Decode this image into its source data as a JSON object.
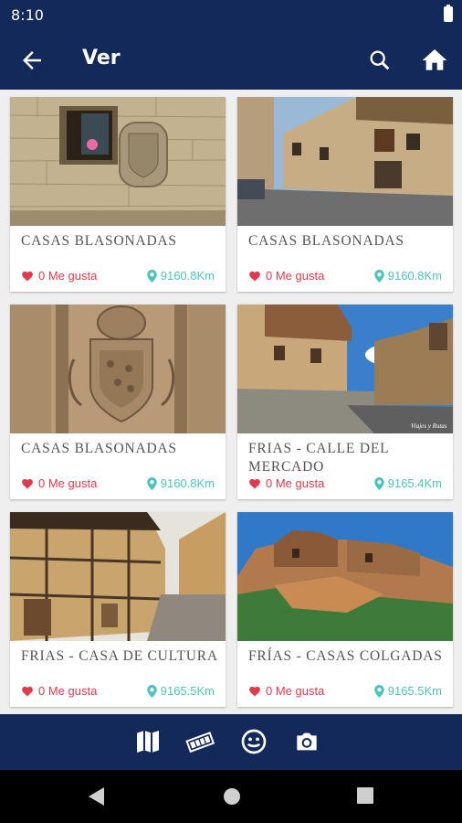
{
  "status": {
    "time": "8:10"
  },
  "appbar": {
    "title": "Ver"
  },
  "items": [
    {
      "title": "CASAS BLASONADAS",
      "likes": "0 Me gusta",
      "distance": "9160.8Km"
    },
    {
      "title": "CASAS BLASONADAS",
      "likes": "0 Me gusta",
      "distance": "9160.8Km"
    },
    {
      "title": "CASAS BLASONADAS",
      "likes": "0 Me gusta",
      "distance": "9160.8Km"
    },
    {
      "title": "FRIAS - CALLE DEL MERCADO",
      "likes": "0 Me gusta",
      "distance": "9165.4Km"
    },
    {
      "title": "FRIAS - CASA DE CULTURA",
      "likes": "0 Me gusta",
      "distance": "9165.5Km"
    },
    {
      "title": "FRÍAS - CASAS COLGADAS",
      "likes": "0 Me gusta",
      "distance": "9165.5Km"
    }
  ],
  "photo_caption": "Viajes y Rutas",
  "colors": {
    "primary": "#13295a",
    "like": "#e13a4d",
    "distance": "#4ec3bd"
  }
}
